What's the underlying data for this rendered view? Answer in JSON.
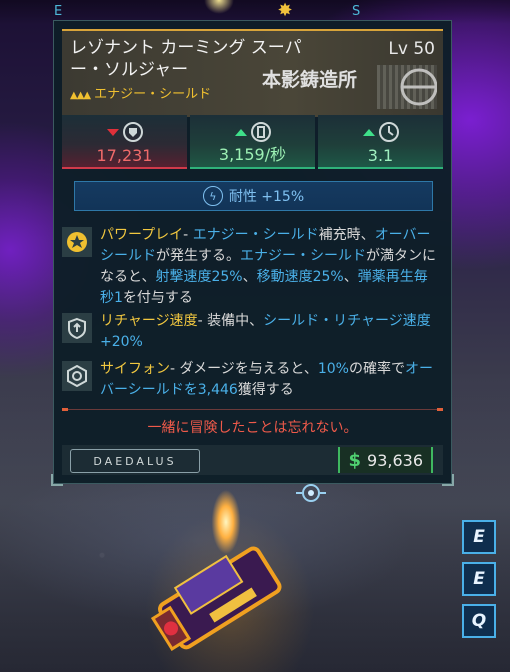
{
  "compass": {
    "left_letter": "E",
    "right_letter": "S"
  },
  "item": {
    "name": "レゾナント カーミング スーパー・ソルジャー",
    "level": "Lv 50",
    "rarity_type": "エナジー・シールド",
    "manufacturer": "本影鋳造所"
  },
  "stats": [
    {
      "name": "capacity",
      "value": "17,231",
      "trend": "down",
      "color": "#f06a6a",
      "icon": "shield-icon"
    },
    {
      "name": "recharge-rate",
      "value": "3,159/秒",
      "trend": "up",
      "color": "#9cf0b4",
      "icon": "recharge-icon"
    },
    {
      "name": "recharge-delay",
      "value": "3.1",
      "trend": "up",
      "color": "#a0f0c0",
      "icon": "timer-icon"
    }
  ],
  "resistance": {
    "label": "耐性 +15%",
    "icon": "lightning-icon"
  },
  "perks": [
    {
      "icon": "star-badge-icon",
      "title": "パワープレイ",
      "segments": [
        {
          "t": "- ",
          "c": ""
        },
        {
          "t": "エナジー・シールド",
          "c": "c"
        },
        {
          "t": "補充時、",
          "c": ""
        },
        {
          "t": "オーバーシールド",
          "c": "c"
        },
        {
          "t": "が発生する。",
          "c": ""
        },
        {
          "t": "エナジー・シールド",
          "c": "c"
        },
        {
          "t": "が満タンになると、",
          "c": ""
        },
        {
          "t": "射撃速度25%",
          "c": "c"
        },
        {
          "t": "、",
          "c": ""
        },
        {
          "t": "移動速度25%",
          "c": "c"
        },
        {
          "t": "、",
          "c": ""
        },
        {
          "t": "弾薬再生毎秒1",
          "c": "c"
        },
        {
          "t": "を付与する",
          "c": ""
        }
      ]
    },
    {
      "icon": "shield-recharge-icon",
      "title": "リチャージ速度",
      "segments": [
        {
          "t": "- 装備中、",
          "c": ""
        },
        {
          "t": "シールド・リチャージ速度+20%",
          "c": "c"
        }
      ]
    },
    {
      "icon": "siphon-icon",
      "title": "サイフォン",
      "segments": [
        {
          "t": "- ダメージを与えると、",
          "c": ""
        },
        {
          "t": "10%",
          "c": "c"
        },
        {
          "t": "の確率で",
          "c": ""
        },
        {
          "t": "オーバーシールドを3,446",
          "c": "c"
        },
        {
          "t": "獲得する",
          "c": ""
        }
      ]
    }
  ],
  "flavor_text": "一緒に冒険したことは忘れない。",
  "brand": "DAEDALUS",
  "price": {
    "currency_symbol": "$",
    "amount": "93,636"
  },
  "hotkeys": [
    "E",
    "E",
    "Q"
  ],
  "colors": {
    "legendary": "#d8a43a",
    "accent": "#4ab0e8",
    "flavor": "#ef5a4a",
    "cash": "#4fd070"
  }
}
